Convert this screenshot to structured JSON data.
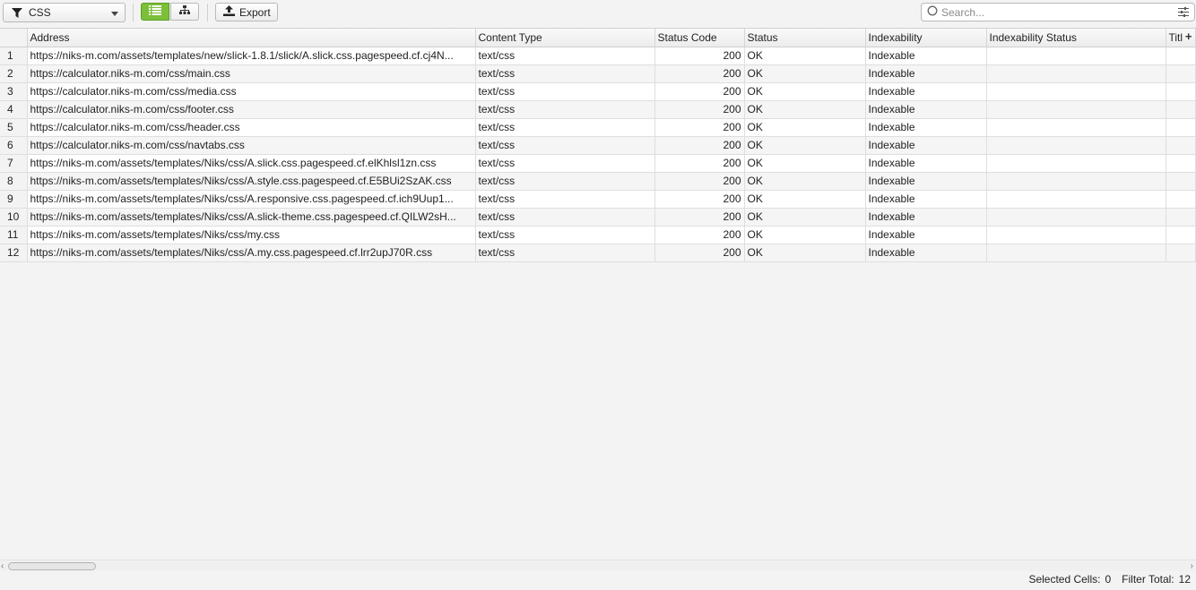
{
  "toolbar": {
    "filter": {
      "value": "CSS",
      "icon": "funnel-icon"
    },
    "view_modes": [
      {
        "name": "list-view",
        "icon": "list-icon",
        "active": true
      },
      {
        "name": "tree-view",
        "icon": "hierarchy-icon",
        "active": false
      }
    ],
    "export_label": "Export",
    "search_placeholder": "Search..."
  },
  "table": {
    "columns": [
      "Address",
      "Content Type",
      "Status Code",
      "Status",
      "Indexability",
      "Indexability Status",
      "Titl"
    ],
    "rows": [
      {
        "n": "1",
        "address": "https://niks-m.com/assets/templates/new/slick-1.8.1/slick/A.slick.css.pagespeed.cf.cj4N...",
        "content_type": "text/css",
        "status_code": "200",
        "status": "OK",
        "indexability": "Indexable",
        "indexability_status": ""
      },
      {
        "n": "2",
        "address": "https://calculator.niks-m.com/css/main.css",
        "content_type": "text/css",
        "status_code": "200",
        "status": "OK",
        "indexability": "Indexable",
        "indexability_status": ""
      },
      {
        "n": "3",
        "address": "https://calculator.niks-m.com/css/media.css",
        "content_type": "text/css",
        "status_code": "200",
        "status": "OK",
        "indexability": "Indexable",
        "indexability_status": ""
      },
      {
        "n": "4",
        "address": "https://calculator.niks-m.com/css/footer.css",
        "content_type": "text/css",
        "status_code": "200",
        "status": "OK",
        "indexability": "Indexable",
        "indexability_status": ""
      },
      {
        "n": "5",
        "address": "https://calculator.niks-m.com/css/header.css",
        "content_type": "text/css",
        "status_code": "200",
        "status": "OK",
        "indexability": "Indexable",
        "indexability_status": ""
      },
      {
        "n": "6",
        "address": "https://calculator.niks-m.com/css/navtabs.css",
        "content_type": "text/css",
        "status_code": "200",
        "status": "OK",
        "indexability": "Indexable",
        "indexability_status": ""
      },
      {
        "n": "7",
        "address": "https://niks-m.com/assets/templates/Niks/css/A.slick.css.pagespeed.cf.elKhlsl1zn.css",
        "content_type": "text/css",
        "status_code": "200",
        "status": "OK",
        "indexability": "Indexable",
        "indexability_status": ""
      },
      {
        "n": "8",
        "address": "https://niks-m.com/assets/templates/Niks/css/A.style.css.pagespeed.cf.E5BUi2SzAK.css",
        "content_type": "text/css",
        "status_code": "200",
        "status": "OK",
        "indexability": "Indexable",
        "indexability_status": ""
      },
      {
        "n": "9",
        "address": "https://niks-m.com/assets/templates/Niks/css/A.responsive.css.pagespeed.cf.ich9Uup1...",
        "content_type": "text/css",
        "status_code": "200",
        "status": "OK",
        "indexability": "Indexable",
        "indexability_status": ""
      },
      {
        "n": "10",
        "address": "https://niks-m.com/assets/templates/Niks/css/A.slick-theme.css.pagespeed.cf.QILW2sH...",
        "content_type": "text/css",
        "status_code": "200",
        "status": "OK",
        "indexability": "Indexable",
        "indexability_status": ""
      },
      {
        "n": "11",
        "address": "https://niks-m.com/assets/templates/Niks/css/my.css",
        "content_type": "text/css",
        "status_code": "200",
        "status": "OK",
        "indexability": "Indexable",
        "indexability_status": ""
      },
      {
        "n": "12",
        "address": "https://niks-m.com/assets/templates/Niks/css/A.my.css.pagespeed.cf.lrr2upJ70R.css",
        "content_type": "text/css",
        "status_code": "200",
        "status": "OK",
        "indexability": "Indexable",
        "indexability_status": ""
      }
    ]
  },
  "statusbar": {
    "selected_label": "Selected Cells:",
    "selected_value": "0",
    "filter_label": "Filter Total:",
    "filter_value": "12"
  },
  "colors": {
    "accent": "#7cbf3a"
  }
}
